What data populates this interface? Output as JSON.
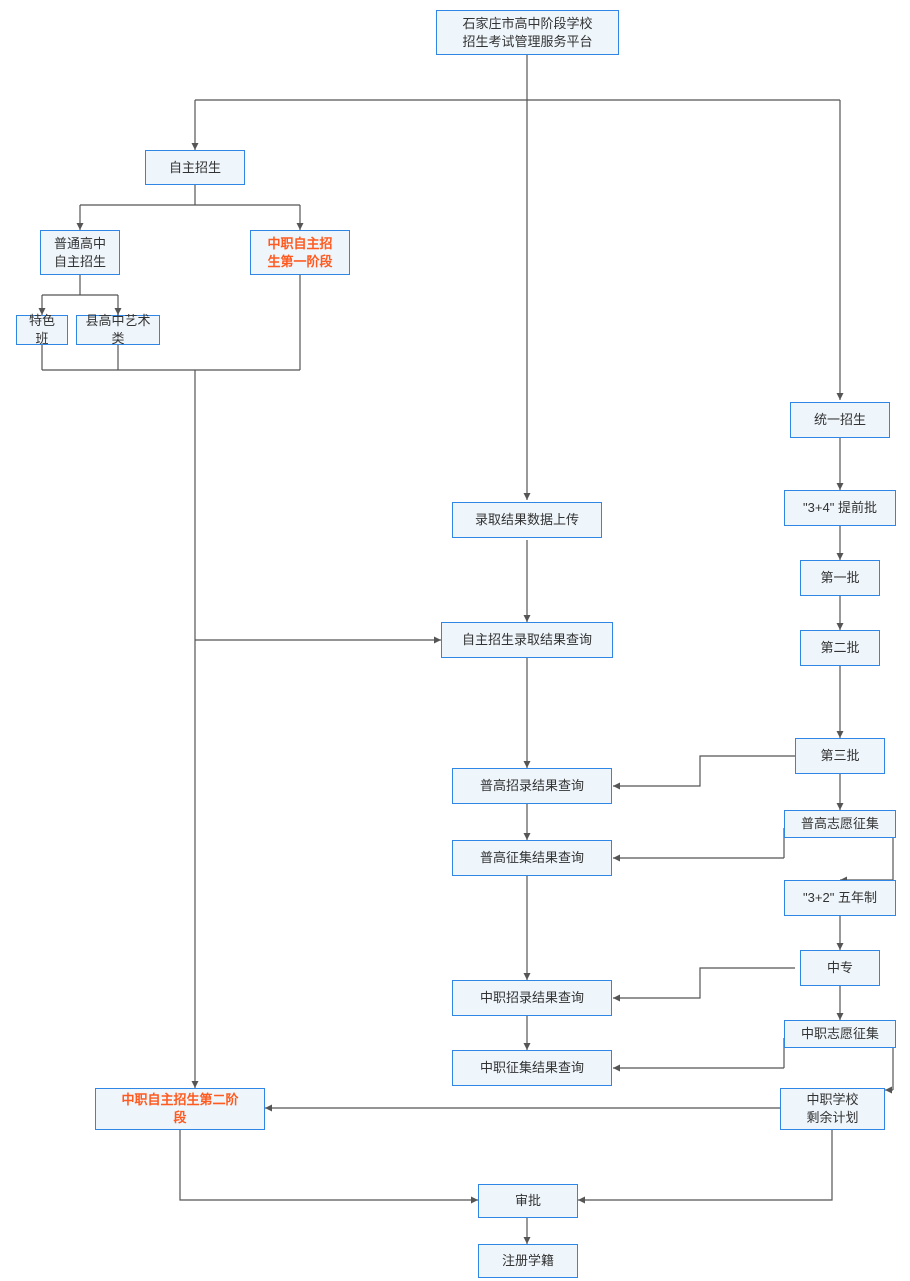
{
  "chart_data": {
    "type": "flowchart",
    "title": "石家庄市高中阶段学校招生考试管理服务平台",
    "nodes": [
      {
        "id": "platform",
        "label": "石家庄市高中阶段学校\n招生考试管理服务平台",
        "highlight": false
      },
      {
        "id": "self_enroll",
        "label": "自主招生",
        "highlight": false
      },
      {
        "id": "pg_self",
        "label": "普通高中\n自主招生",
        "highlight": false
      },
      {
        "id": "zz_self_p1",
        "label": "中职自主招\n生第一阶段",
        "highlight": true
      },
      {
        "id": "tese",
        "label": "特色班",
        "highlight": false
      },
      {
        "id": "xgyishu",
        "label": "县高中艺术类",
        "highlight": false
      },
      {
        "id": "upload",
        "label": "录取结果数据上传",
        "highlight": false
      },
      {
        "id": "self_query",
        "label": "自主招生录取结果查询",
        "highlight": false
      },
      {
        "id": "pg_query",
        "label": "普高招录结果查询",
        "highlight": false
      },
      {
        "id": "pg_zj_query",
        "label": "普高征集结果查询",
        "highlight": false
      },
      {
        "id": "zz_query",
        "label": "中职招录结果查询",
        "highlight": false
      },
      {
        "id": "zz_zj_query",
        "label": "中职征集结果查询",
        "highlight": false
      },
      {
        "id": "unified",
        "label": "统一招生",
        "highlight": false
      },
      {
        "id": "b34",
        "label": "\"3+4\" 提前批",
        "highlight": false
      },
      {
        "id": "batch1",
        "label": "第一批",
        "highlight": false
      },
      {
        "id": "batch2",
        "label": "第二批",
        "highlight": false
      },
      {
        "id": "batch3",
        "label": "第三批",
        "highlight": false
      },
      {
        "id": "pg_zhengji",
        "label": "普高志愿征集",
        "highlight": false
      },
      {
        "id": "b32",
        "label": "\"3+2\" 五年制",
        "highlight": false
      },
      {
        "id": "zhongzhuan",
        "label": "中专",
        "highlight": false
      },
      {
        "id": "zz_zhengji",
        "label": "中职志愿征集",
        "highlight": false
      },
      {
        "id": "zz_remain",
        "label": "中职学校\n剩余计划",
        "highlight": false
      },
      {
        "id": "zz_self_p2",
        "label": "中职自主招生第二阶\n段",
        "highlight": true
      },
      {
        "id": "shenpi",
        "label": "审批",
        "highlight": false
      },
      {
        "id": "zhuce",
        "label": "注册学籍",
        "highlight": false
      }
    ],
    "edges": [
      {
        "from": "platform",
        "to": "self_enroll"
      },
      {
        "from": "platform",
        "to": "upload"
      },
      {
        "from": "platform",
        "to": "unified"
      },
      {
        "from": "self_enroll",
        "to": "pg_self"
      },
      {
        "from": "self_enroll",
        "to": "zz_self_p1"
      },
      {
        "from": "pg_self",
        "to": "tese"
      },
      {
        "from": "pg_self",
        "to": "xgyishu"
      },
      {
        "from": "tese",
        "to": "self_query",
        "note": "merged flow via left trunk"
      },
      {
        "from": "xgyishu",
        "to": "self_query",
        "note": "merged flow via left trunk"
      },
      {
        "from": "zz_self_p1",
        "to": "self_query",
        "note": "merged flow via left trunk"
      },
      {
        "from": "upload",
        "to": "self_query"
      },
      {
        "from": "self_query",
        "to": "pg_query"
      },
      {
        "from": "pg_query",
        "to": "pg_zj_query"
      },
      {
        "from": "pg_zj_query",
        "to": "zz_query"
      },
      {
        "from": "zz_query",
        "to": "zz_zj_query"
      },
      {
        "from": "unified",
        "to": "b34"
      },
      {
        "from": "b34",
        "to": "batch1"
      },
      {
        "from": "batch1",
        "to": "batch2"
      },
      {
        "from": "batch2",
        "to": "batch3"
      },
      {
        "from": "batch3",
        "to": "pg_query"
      },
      {
        "from": "batch3",
        "to": "pg_zhengji"
      },
      {
        "from": "pg_zhengji",
        "to": "pg_zj_query"
      },
      {
        "from": "pg_zhengji",
        "to": "b32"
      },
      {
        "from": "b32",
        "to": "zhongzhuan"
      },
      {
        "from": "zhongzhuan",
        "to": "zz_query"
      },
      {
        "from": "zhongzhuan",
        "to": "zz_zhengji"
      },
      {
        "from": "zz_zhengji",
        "to": "zz_zj_query"
      },
      {
        "from": "zz_zhengji",
        "to": "zz_remain"
      },
      {
        "from": "zz_remain",
        "to": "zz_self_p2"
      },
      {
        "from": "zz_self_p2",
        "to": "shenpi"
      },
      {
        "from": "zz_remain",
        "to": "shenpi"
      },
      {
        "from": "left_trunk",
        "to": "zz_self_p2",
        "note": "long left vertical flow"
      },
      {
        "from": "shenpi",
        "to": "zhuce"
      }
    ]
  },
  "labels": {
    "platform": "石家庄市高中阶段学校\n招生考试管理服务平台",
    "self_enroll": "自主招生",
    "pg_self": "普通高中\n自主招生",
    "zz_self_p1": "中职自主招\n生第一阶段",
    "tese": "特色班",
    "xgyishu": "县高中艺术类",
    "upload": "录取结果数据上传",
    "self_query": "自主招生录取结果查询",
    "pg_query": "普高招录结果查询",
    "pg_zj_query": "普高征集结果查询",
    "zz_query": "中职招录结果查询",
    "zz_zj_query": "中职征集结果查询",
    "unified": "统一招生",
    "b34": "\"3+4\" 提前批",
    "batch1": "第一批",
    "batch2": "第二批",
    "batch3": "第三批",
    "pg_zhengji": "普高志愿征集",
    "b32": "\"3+2\" 五年制",
    "zhongzhuan": "中专",
    "zz_zhengji": "中职志愿征集",
    "zz_remain": "中职学校\n剩余计划",
    "zz_self_p2": "中职自主招生第二阶\n段",
    "shenpi": "审批",
    "zhuce": "注册学籍"
  }
}
